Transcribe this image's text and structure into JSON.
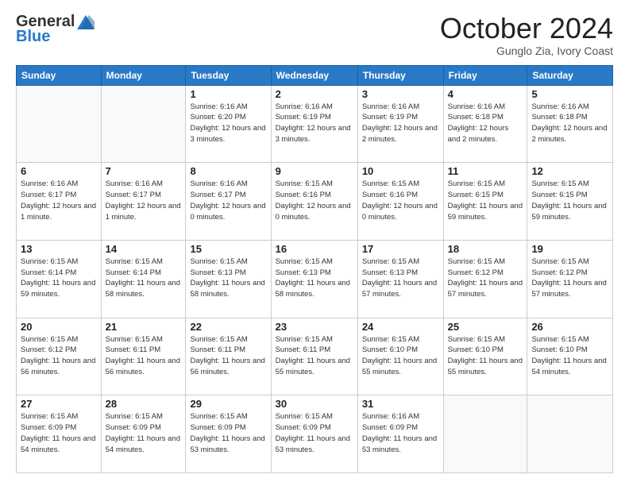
{
  "header": {
    "logo_general": "General",
    "logo_blue": "Blue",
    "month_title": "October 2024",
    "location": "Gunglo Zia, Ivory Coast"
  },
  "days_of_week": [
    "Sunday",
    "Monday",
    "Tuesday",
    "Wednesday",
    "Thursday",
    "Friday",
    "Saturday"
  ],
  "weeks": [
    [
      {
        "day": "",
        "info": ""
      },
      {
        "day": "",
        "info": ""
      },
      {
        "day": "1",
        "info": "Sunrise: 6:16 AM\nSunset: 6:20 PM\nDaylight: 12 hours and 3 minutes."
      },
      {
        "day": "2",
        "info": "Sunrise: 6:16 AM\nSunset: 6:19 PM\nDaylight: 12 hours and 3 minutes."
      },
      {
        "day": "3",
        "info": "Sunrise: 6:16 AM\nSunset: 6:19 PM\nDaylight: 12 hours and 2 minutes."
      },
      {
        "day": "4",
        "info": "Sunrise: 6:16 AM\nSunset: 6:18 PM\nDaylight: 12 hours and 2 minutes."
      },
      {
        "day": "5",
        "info": "Sunrise: 6:16 AM\nSunset: 6:18 PM\nDaylight: 12 hours and 2 minutes."
      }
    ],
    [
      {
        "day": "6",
        "info": "Sunrise: 6:16 AM\nSunset: 6:17 PM\nDaylight: 12 hours and 1 minute."
      },
      {
        "day": "7",
        "info": "Sunrise: 6:16 AM\nSunset: 6:17 PM\nDaylight: 12 hours and 1 minute."
      },
      {
        "day": "8",
        "info": "Sunrise: 6:16 AM\nSunset: 6:17 PM\nDaylight: 12 hours and 0 minutes."
      },
      {
        "day": "9",
        "info": "Sunrise: 6:15 AM\nSunset: 6:16 PM\nDaylight: 12 hours and 0 minutes."
      },
      {
        "day": "10",
        "info": "Sunrise: 6:15 AM\nSunset: 6:16 PM\nDaylight: 12 hours and 0 minutes."
      },
      {
        "day": "11",
        "info": "Sunrise: 6:15 AM\nSunset: 6:15 PM\nDaylight: 11 hours and 59 minutes."
      },
      {
        "day": "12",
        "info": "Sunrise: 6:15 AM\nSunset: 6:15 PM\nDaylight: 11 hours and 59 minutes."
      }
    ],
    [
      {
        "day": "13",
        "info": "Sunrise: 6:15 AM\nSunset: 6:14 PM\nDaylight: 11 hours and 59 minutes."
      },
      {
        "day": "14",
        "info": "Sunrise: 6:15 AM\nSunset: 6:14 PM\nDaylight: 11 hours and 58 minutes."
      },
      {
        "day": "15",
        "info": "Sunrise: 6:15 AM\nSunset: 6:13 PM\nDaylight: 11 hours and 58 minutes."
      },
      {
        "day": "16",
        "info": "Sunrise: 6:15 AM\nSunset: 6:13 PM\nDaylight: 11 hours and 58 minutes."
      },
      {
        "day": "17",
        "info": "Sunrise: 6:15 AM\nSunset: 6:13 PM\nDaylight: 11 hours and 57 minutes."
      },
      {
        "day": "18",
        "info": "Sunrise: 6:15 AM\nSunset: 6:12 PM\nDaylight: 11 hours and 57 minutes."
      },
      {
        "day": "19",
        "info": "Sunrise: 6:15 AM\nSunset: 6:12 PM\nDaylight: 11 hours and 57 minutes."
      }
    ],
    [
      {
        "day": "20",
        "info": "Sunrise: 6:15 AM\nSunset: 6:12 PM\nDaylight: 11 hours and 56 minutes."
      },
      {
        "day": "21",
        "info": "Sunrise: 6:15 AM\nSunset: 6:11 PM\nDaylight: 11 hours and 56 minutes."
      },
      {
        "day": "22",
        "info": "Sunrise: 6:15 AM\nSunset: 6:11 PM\nDaylight: 11 hours and 56 minutes."
      },
      {
        "day": "23",
        "info": "Sunrise: 6:15 AM\nSunset: 6:11 PM\nDaylight: 11 hours and 55 minutes."
      },
      {
        "day": "24",
        "info": "Sunrise: 6:15 AM\nSunset: 6:10 PM\nDaylight: 11 hours and 55 minutes."
      },
      {
        "day": "25",
        "info": "Sunrise: 6:15 AM\nSunset: 6:10 PM\nDaylight: 11 hours and 55 minutes."
      },
      {
        "day": "26",
        "info": "Sunrise: 6:15 AM\nSunset: 6:10 PM\nDaylight: 11 hours and 54 minutes."
      }
    ],
    [
      {
        "day": "27",
        "info": "Sunrise: 6:15 AM\nSunset: 6:09 PM\nDaylight: 11 hours and 54 minutes."
      },
      {
        "day": "28",
        "info": "Sunrise: 6:15 AM\nSunset: 6:09 PM\nDaylight: 11 hours and 54 minutes."
      },
      {
        "day": "29",
        "info": "Sunrise: 6:15 AM\nSunset: 6:09 PM\nDaylight: 11 hours and 53 minutes."
      },
      {
        "day": "30",
        "info": "Sunrise: 6:15 AM\nSunset: 6:09 PM\nDaylight: 11 hours and 53 minutes."
      },
      {
        "day": "31",
        "info": "Sunrise: 6:16 AM\nSunset: 6:09 PM\nDaylight: 11 hours and 53 minutes."
      },
      {
        "day": "",
        "info": ""
      },
      {
        "day": "",
        "info": ""
      }
    ]
  ]
}
